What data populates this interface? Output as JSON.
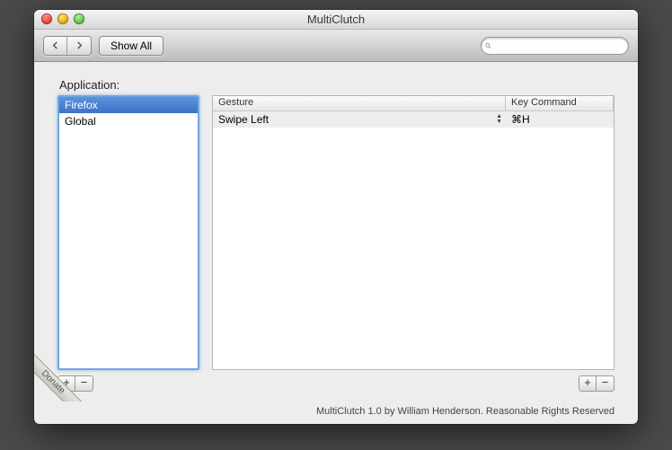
{
  "window": {
    "title": "MultiClutch"
  },
  "toolbar": {
    "show_all_label": "Show All",
    "search_placeholder": ""
  },
  "labels": {
    "application": "Application:"
  },
  "applications": [
    {
      "name": "Firefox",
      "selected": true
    },
    {
      "name": "Global",
      "selected": false
    }
  ],
  "table": {
    "headers": {
      "gesture": "Gesture",
      "key": "Key Command"
    },
    "rows": [
      {
        "gesture": "Swipe Left",
        "key": "⌘H"
      }
    ]
  },
  "footer": {
    "text": "MultiClutch 1.0 by William Henderson.  Reasonable Rights Reserved"
  },
  "ribbon": {
    "label": "Donate"
  },
  "buttons": {
    "plus": "+",
    "minus": "−"
  }
}
